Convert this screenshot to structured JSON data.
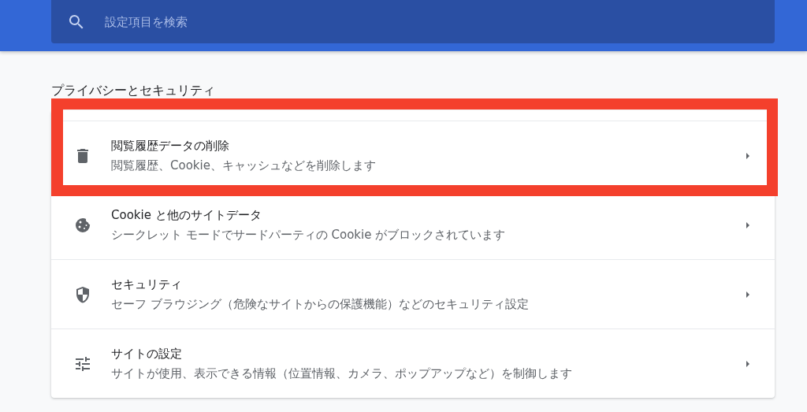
{
  "search": {
    "placeholder": "設定項目を検索"
  },
  "section": {
    "title": "プライバシーとセキュリティ"
  },
  "items": [
    {
      "kind": "trash",
      "title": "閲覧履歴データの削除",
      "subtitle": "閲覧履歴、Cookie、キャッシュなどを削除します",
      "highlighted": true
    },
    {
      "kind": "cookie",
      "title": "Cookie と他のサイトデータ",
      "subtitle": "シークレット モードでサードパーティの Cookie がブロックされています",
      "highlighted": false
    },
    {
      "kind": "shield",
      "title": "セキュリティ",
      "subtitle": "セーフ ブラウジング（危険なサイトからの保護機能）などのセキュリティ設定",
      "highlighted": false
    },
    {
      "kind": "sliders",
      "title": "サイトの設定",
      "subtitle": "サイトが使用、表示できる情報（位置情報、カメラ、ポップアップなど）を制御します",
      "highlighted": false
    }
  ]
}
